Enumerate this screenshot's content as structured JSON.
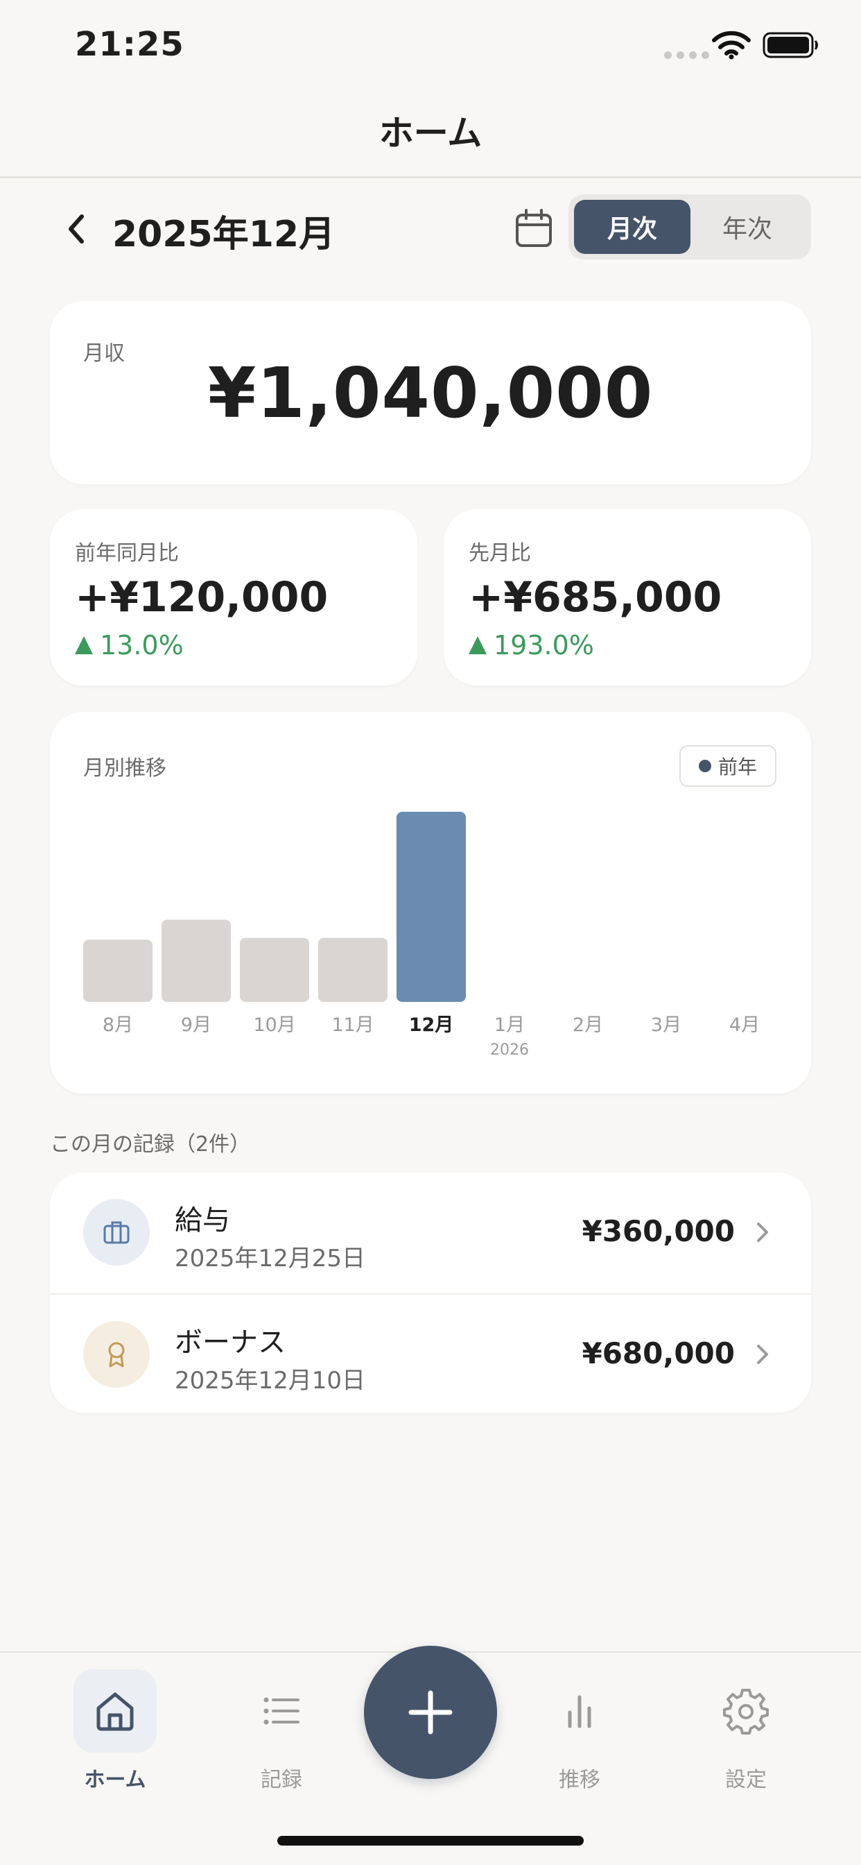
{
  "status_bar": {
    "time": "21:25"
  },
  "header": {
    "title": "ホーム"
  },
  "period": {
    "label": "2025年12月",
    "toggle": {
      "monthly": "月次",
      "yearly": "年次",
      "selected": "月次"
    }
  },
  "income": {
    "label": "月収",
    "amount": "¥1,040,000"
  },
  "comparisons": [
    {
      "label": "前年同月比",
      "amount": "+¥120,000",
      "percent": "13.0%"
    },
    {
      "label": "先月比",
      "amount": "+¥685,000",
      "percent": "193.0%"
    }
  ],
  "chart": {
    "title": "月別推移",
    "legend": "前年"
  },
  "chart_data": {
    "type": "bar",
    "categories": [
      "8月",
      "9月",
      "10月",
      "11月",
      "12月",
      "1月",
      "2月",
      "3月",
      "4月"
    ],
    "sublabels": [
      "",
      "",
      "",
      "",
      "",
      "2026",
      "",
      "",
      ""
    ],
    "values": [
      340000,
      450000,
      350000,
      350000,
      1040000,
      null,
      null,
      null,
      null
    ],
    "highlight_index": 4,
    "colors": {
      "normal": "#d8d5d2",
      "current": "#6b8cb0"
    },
    "ylim": [
      0,
      1040000
    ]
  },
  "records": {
    "heading": "この月の記録（2件）",
    "items": [
      {
        "name": "給与",
        "date": "2025年12月25日",
        "amount": "¥360,000",
        "icon": "briefcase-icon"
      },
      {
        "name": "ボーナス",
        "date": "2025年12月10日",
        "amount": "¥680,000",
        "icon": "award-ribbon-icon"
      }
    ]
  },
  "tabs": [
    {
      "label": "ホーム",
      "icon": "home-icon",
      "active": true
    },
    {
      "label": "記録",
      "icon": "list-icon",
      "active": false
    },
    {
      "label": "推移",
      "icon": "bar-chart-icon",
      "active": false
    },
    {
      "label": "設定",
      "icon": "gear-icon",
      "active": false
    }
  ],
  "colors": {
    "accent": "#46546a",
    "positive": "#3d9a5d",
    "background": "#f8f7f5"
  }
}
